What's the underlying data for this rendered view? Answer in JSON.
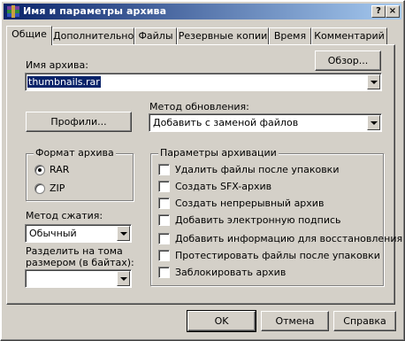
{
  "window": {
    "title": "Имя и параметры архива",
    "help_btn": "?",
    "close_btn": "×"
  },
  "tabs": [
    {
      "label": "Общие",
      "active": true
    },
    {
      "label": "Дополнительно"
    },
    {
      "label": "Файлы"
    },
    {
      "label": "Резервные копии"
    },
    {
      "label": "Время"
    },
    {
      "label": "Комментарий"
    }
  ],
  "archive_name": {
    "label": "Имя архива:",
    "value": "thumbnails.rar",
    "browse_btn": "Обзор..."
  },
  "profiles_btn": "Профили...",
  "update_method": {
    "label": "Метод обновления:",
    "value": "Добавить с заменой файлов"
  },
  "archive_format": {
    "title": "Формат архива",
    "options": [
      {
        "label": "RAR",
        "selected": true
      },
      {
        "label": "ZIP",
        "selected": false
      }
    ]
  },
  "compression": {
    "label": "Метод сжатия:",
    "value": "Обычный"
  },
  "split_volumes": {
    "label_line1": "Разделить на тома",
    "label_line2": "размером (в байтах):",
    "value": ""
  },
  "archive_options": {
    "title": "Параметры архивации",
    "items": [
      {
        "label": "Удалить файлы после упаковки",
        "checked": false
      },
      {
        "label": "Создать SFX-архив",
        "checked": false
      },
      {
        "label": "Создать непрерывный архив",
        "checked": false
      },
      {
        "label": "Добавить электронную подпись",
        "checked": false
      },
      {
        "label": "Добавить информацию для восстановления",
        "checked": false
      },
      {
        "label": "Протестировать файлы после упаковки",
        "checked": false
      },
      {
        "label": "Заблокировать архив",
        "checked": false
      }
    ]
  },
  "footer": {
    "ok": "OK",
    "cancel": "Отмена",
    "help": "Справка"
  }
}
